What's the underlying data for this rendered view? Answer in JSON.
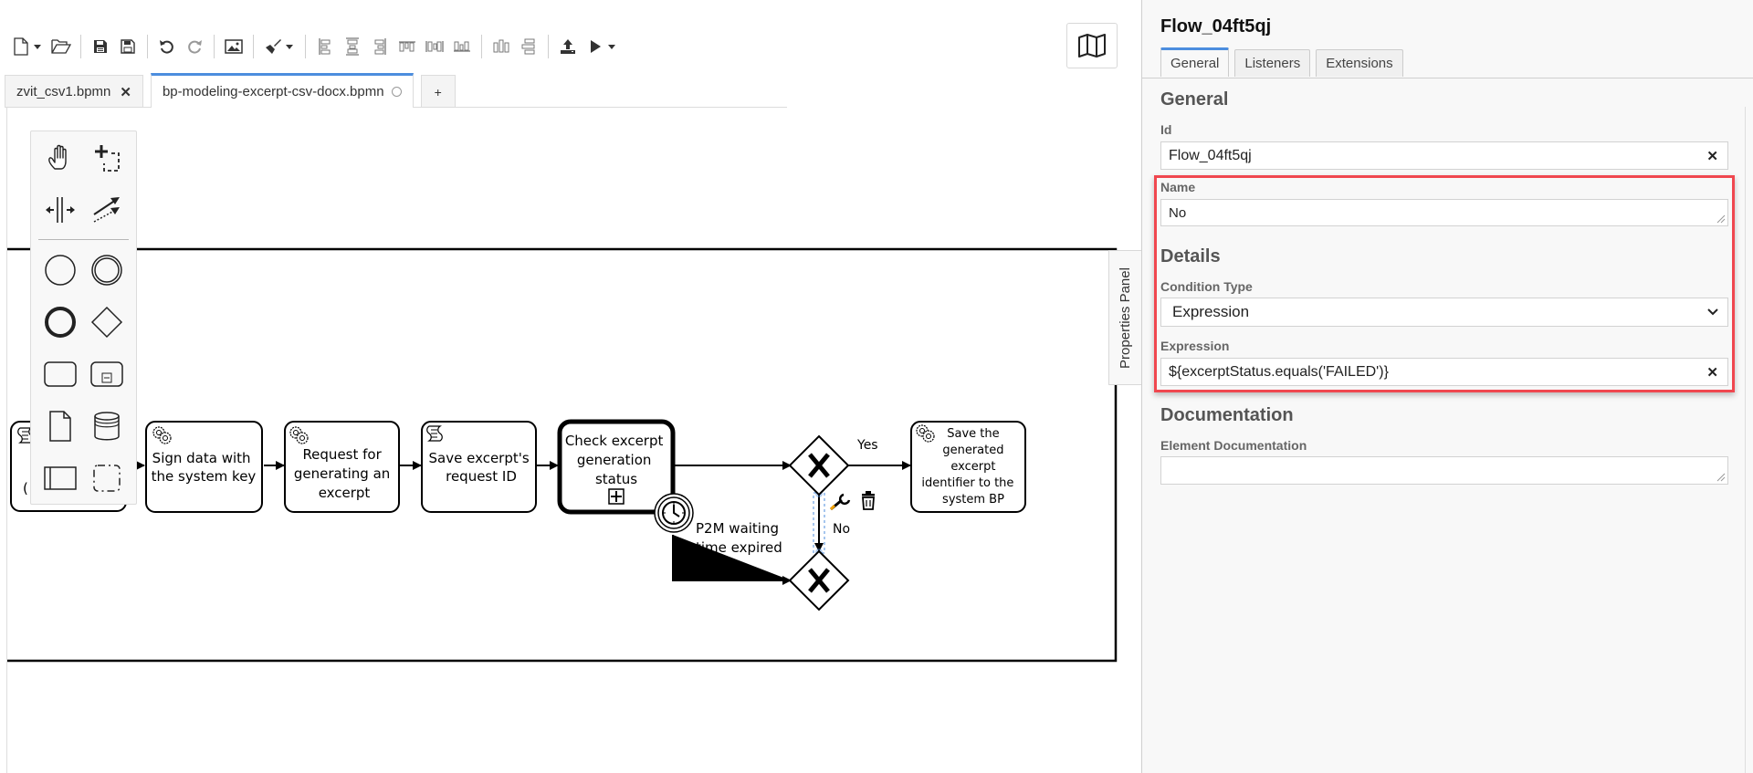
{
  "toolbar": {
    "buttons": [
      {
        "name": "new-file",
        "icon": "new-file-icon",
        "has_dropdown": true
      },
      {
        "name": "open-file",
        "icon": "folder-open-icon"
      },
      {
        "name": "save",
        "icon": "save-icon"
      },
      {
        "name": "save-as",
        "icon": "save-as-icon"
      },
      {
        "name": "undo",
        "icon": "undo-icon"
      },
      {
        "name": "redo",
        "icon": "redo-icon"
      },
      {
        "name": "export-image",
        "icon": "image-icon"
      },
      {
        "name": "color",
        "icon": "paint-brush-icon",
        "has_dropdown": true
      },
      {
        "name": "align-left",
        "icon": "align-left-icon"
      },
      {
        "name": "align-center",
        "icon": "align-center-icon"
      },
      {
        "name": "align-right",
        "icon": "align-right-icon"
      },
      {
        "name": "align-top",
        "icon": "align-top-icon"
      },
      {
        "name": "align-middle",
        "icon": "align-middle-icon"
      },
      {
        "name": "align-bottom",
        "icon": "align-bottom-icon"
      },
      {
        "name": "distribute-horizontal",
        "icon": "distribute-horizontal-icon"
      },
      {
        "name": "distribute-vertical",
        "icon": "distribute-vertical-icon"
      },
      {
        "name": "deploy",
        "icon": "deploy-icon"
      },
      {
        "name": "start-instance",
        "icon": "play-icon",
        "has_dropdown": true
      }
    ]
  },
  "minimap": {
    "icon": "map-icon"
  },
  "tabs": [
    {
      "label": "zvit_csv1.bpmn",
      "active": false,
      "state": "close"
    },
    {
      "label": "bp-modeling-excerpt-csv-docx.bpmn",
      "active": true,
      "state": "unsaved"
    },
    {
      "label": "+",
      "active": false,
      "state": "add"
    }
  ],
  "palette": {
    "tools": [
      "hand-tool",
      "lasso-tool",
      "space-tool",
      "global-connect-tool"
    ],
    "elements": [
      "start-event",
      "intermediate-event",
      "end-event",
      "gateway",
      "task",
      "subprocess",
      "data-object",
      "data-store",
      "participant-pool",
      "group"
    ]
  },
  "diagram": {
    "tasks": [
      {
        "id": "t0",
        "label": "(",
        "type": "script"
      },
      {
        "id": "t1",
        "label": "Sign data with the system key",
        "lines": [
          "Sign data with",
          "the system key"
        ],
        "type": "service"
      },
      {
        "id": "t2",
        "label": "Request for generating an excerpt",
        "lines": [
          "Request for",
          "generating an",
          "excerpt"
        ],
        "type": "service"
      },
      {
        "id": "t3",
        "label": "Save excerpt's request ID",
        "lines": [
          "Save excerpt's",
          "request ID"
        ],
        "type": "script"
      },
      {
        "id": "t4",
        "label": "Check excerpt generation status",
        "lines": [
          "Check excerpt",
          "generation",
          "status"
        ],
        "type": "subprocess"
      },
      {
        "id": "t5",
        "label": "Save the generated excerpt identifier to the system BP",
        "lines": [
          "Save the",
          "generated",
          "excerpt",
          "identifier to the",
          "system BP"
        ],
        "type": "service"
      }
    ],
    "boundary_event": {
      "label": "P2M waiting time expired",
      "lines": [
        "P2M waiting",
        "time  expired"
      ],
      "type": "timer"
    },
    "flows": [
      {
        "label": "Yes"
      },
      {
        "label": "No",
        "selected": true
      }
    ]
  },
  "properties_toggle": {
    "label": "Properties Panel"
  },
  "properties": {
    "title": "Flow_04ft5qj",
    "tabs": [
      {
        "label": "General",
        "active": true
      },
      {
        "label": "Listeners",
        "active": false
      },
      {
        "label": "Extensions",
        "active": false
      }
    ],
    "general_heading": "General",
    "id_label": "Id",
    "id_value": "Flow_04ft5qj",
    "name_label": "Name",
    "name_value": "No",
    "details_heading": "Details",
    "condition_type_label": "Condition Type",
    "condition_type_value": "Expression",
    "expression_label": "Expression",
    "expression_value": "${excerptStatus.equals('FAILED')}",
    "documentation_heading": "Documentation",
    "element_documentation_label": "Element Documentation",
    "element_documentation_value": "",
    "highlight_color": "#f0474f",
    "accent_color": "#4c8dde"
  }
}
